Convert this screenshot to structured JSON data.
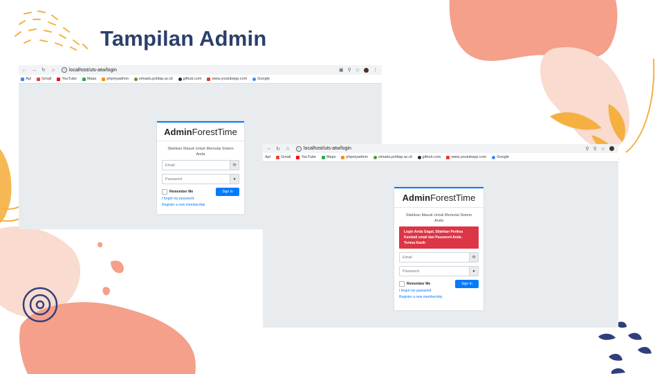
{
  "slide": {
    "title": "Tampilan Admin"
  },
  "colors": {
    "title": "#2b3f6b",
    "coral": "#f4a08a",
    "peach": "#f9dbcf",
    "mustard": "#f5b041",
    "navy": "#2f3f7a",
    "primary": "#007bff",
    "danger": "#dc3545",
    "page_bg": "#e9ecef"
  },
  "browser1": {
    "url": "localhost/uts-atw/login",
    "bookmarks": [
      "Apl",
      "Gmail",
      "YouTube",
      "Maps",
      "phpmyadmin",
      "simadu.politap.ac.id",
      "github.com",
      "www.youtubepp.com",
      "Google"
    ],
    "card": {
      "brand_bold": "Admin",
      "brand_rest": "ForestTime",
      "message": "Silahkan Masuk Untuk Memulai Sistem Anda",
      "email_placeholder": "Email",
      "password_placeholder": "Password",
      "remember_label": "Remember Me",
      "signin_label": "Sign In",
      "forgot_link": "I forgot my password",
      "register_link": "Register a new membership"
    }
  },
  "browser2": {
    "url": "localhost/uts-atw/login",
    "bookmarks": [
      "Apl",
      "Gmail",
      "YouTube",
      "Maps",
      "phpmyadmin",
      "simadu.politap.ac.id",
      "github.com",
      "www.youtubepp.com",
      "Google"
    ],
    "card": {
      "brand_bold": "Admin",
      "brand_rest": "ForestTime",
      "message": "Silahkan Masuk Untuk Memulai Sistem Anda",
      "alert": "Login Anda Gagal, Silahkan Periksa Kembali email dan Password Anda. Terima Kasih",
      "email_placeholder": "Email",
      "password_placeholder": "Password",
      "remember_label": "Remember Me",
      "signin_label": "Sign In",
      "forgot_link": "I forgot my password",
      "register_link": "Register a new membership"
    }
  },
  "icons": [
    "back-icon",
    "forward-icon",
    "reload-icon",
    "home-icon",
    "translate-icon",
    "zoom-icon",
    "star-icon",
    "avatar",
    "menu-icon",
    "envelope-icon",
    "lock-icon"
  ]
}
